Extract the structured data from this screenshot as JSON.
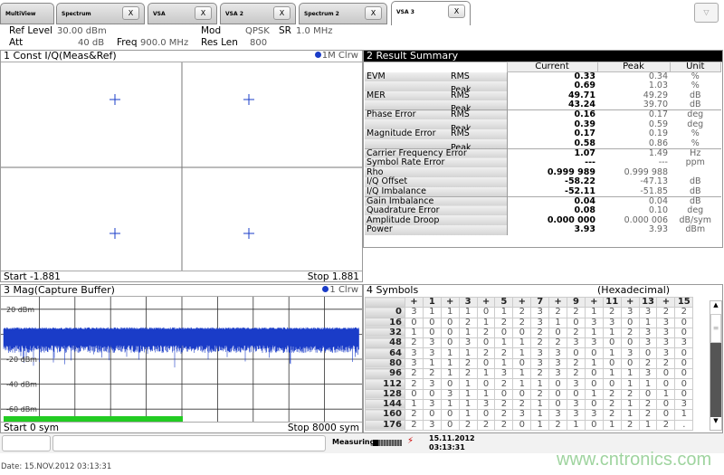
{
  "tabs": [
    {
      "label": "MultiView"
    },
    {
      "label": "Spectrum"
    },
    {
      "label": "VSA"
    },
    {
      "label": "VSA 2"
    },
    {
      "label": "Spectrum 2"
    },
    {
      "label": "VSA 3",
      "active": true
    }
  ],
  "tab_close": "X",
  "dropdown": "▽",
  "settings": {
    "ref_level_label": "Ref Level",
    "ref_level": "30.00 dBm",
    "att_label": "Att",
    "att": "40 dB",
    "freq_label": "Freq",
    "freq": "900.0 MHz",
    "mod_label": "Mod",
    "mod": "QPSK",
    "sr_label": "SR",
    "sr": "1.0 MHz",
    "reslen_label": "Res Len",
    "reslen": "800"
  },
  "const_panel": {
    "title": "1 Const I/Q(Meas&Ref)",
    "trace": "1M Clrw",
    "start": "Start -1.881",
    "stop": "Stop 1.881"
  },
  "mag_panel": {
    "title": "3 Mag(Capture Buffer)",
    "trace": "1 Clrw",
    "start": "Start 0 sym",
    "stop": "Stop 8000 sym",
    "y_labels": [
      "20 dBm",
      "-20 dBm",
      "-40 dBm",
      "-60 dBm"
    ],
    "capture_progress": 0.5
  },
  "summary": {
    "title": "2 Result Summary",
    "headers": [
      "Current",
      "Peak",
      "Unit"
    ],
    "rows": [
      [
        "EVM",
        "RMS",
        "0.33",
        "0.34",
        "%"
      ],
      [
        "",
        "Peak",
        "0.69",
        "1.03",
        "%"
      ],
      [
        "MER",
        "RMS",
        "49.71",
        "49.29",
        "dB"
      ],
      [
        "",
        "Peak",
        "43.24",
        "39.70",
        "dB"
      ],
      [
        "Phase Error",
        "RMS",
        "0.16",
        "0.17",
        "deg"
      ],
      [
        "",
        "Peak",
        "0.39",
        "0.59",
        "deg"
      ],
      [
        "Magnitude Error",
        "RMS",
        "0.17",
        "0.19",
        "%"
      ],
      [
        "",
        "Peak",
        "0.58",
        "0.86",
        "%"
      ],
      [
        "Carrier Frequency Error",
        "",
        "1.07",
        "1.49",
        "Hz"
      ],
      [
        "Symbol Rate Error",
        "",
        "---",
        "---",
        "ppm"
      ],
      [
        "Rho",
        "",
        "0.999 989",
        "0.999 988",
        ""
      ],
      [
        "I/Q Offset",
        "",
        "-58.22",
        "-47.13",
        "dB"
      ],
      [
        "I/Q Imbalance",
        "",
        "-52.11",
        "-51.85",
        "dB"
      ],
      [
        "Gain Imbalance",
        "",
        "0.04",
        "0.04",
        "dB"
      ],
      [
        "Quadrature Error",
        "",
        "0.08",
        "0.10",
        "deg"
      ],
      [
        "Amplitude Droop",
        "",
        "0.000 000",
        "0.000 006",
        "dB/sym"
      ],
      [
        "Power",
        "",
        "3.93",
        "3.93",
        "dBm"
      ]
    ]
  },
  "symbols": {
    "title": "4 Symbols",
    "format": "(Hexadecimal)",
    "col_headers": [
      "+",
      "1",
      "+",
      "3",
      "+",
      "5",
      "+",
      "7",
      "+",
      "9",
      "+",
      "11",
      "+",
      "13",
      "+",
      "15"
    ],
    "rows": [
      {
        "offset": "0",
        "values": [
          "3",
          "1",
          "1",
          "1",
          "0",
          "1",
          "2",
          "3",
          "2",
          "2",
          "1",
          "2",
          "3",
          "3",
          "2",
          "2"
        ]
      },
      {
        "offset": "16",
        "values": [
          "0",
          "0",
          "0",
          "2",
          "1",
          "2",
          "2",
          "3",
          "1",
          "0",
          "3",
          "3",
          "0",
          "1",
          "3",
          "0"
        ]
      },
      {
        "offset": "32",
        "values": [
          "1",
          "0",
          "0",
          "1",
          "2",
          "0",
          "0",
          "2",
          "0",
          "2",
          "1",
          "1",
          "2",
          "3",
          "3",
          "0"
        ]
      },
      {
        "offset": "48",
        "values": [
          "2",
          "3",
          "0",
          "3",
          "0",
          "1",
          "1",
          "2",
          "2",
          "3",
          "3",
          "0",
          "0",
          "3",
          "3",
          "3"
        ]
      },
      {
        "offset": "64",
        "values": [
          "3",
          "3",
          "1",
          "1",
          "2",
          "2",
          "1",
          "3",
          "3",
          "0",
          "0",
          "1",
          "3",
          "0",
          "3",
          "0"
        ]
      },
      {
        "offset": "80",
        "values": [
          "3",
          "1",
          "1",
          "2",
          "0",
          "1",
          "0",
          "3",
          "3",
          "2",
          "1",
          "0",
          "0",
          "2",
          "2",
          "0"
        ]
      },
      {
        "offset": "96",
        "values": [
          "2",
          "2",
          "1",
          "2",
          "1",
          "3",
          "1",
          "2",
          "3",
          "2",
          "0",
          "1",
          "1",
          "3",
          "0",
          "0"
        ]
      },
      {
        "offset": "112",
        "values": [
          "2",
          "3",
          "0",
          "1",
          "0",
          "2",
          "1",
          "1",
          "0",
          "3",
          "0",
          "0",
          "1",
          "1",
          "0",
          "0"
        ]
      },
      {
        "offset": "128",
        "values": [
          "0",
          "0",
          "3",
          "1",
          "1",
          "0",
          "0",
          "2",
          "0",
          "0",
          "1",
          "2",
          "2",
          "0",
          "1",
          "0"
        ]
      },
      {
        "offset": "144",
        "values": [
          "1",
          "3",
          "1",
          "1",
          "3",
          "2",
          "2",
          "1",
          "0",
          "3",
          "0",
          "2",
          "1",
          "2",
          "0",
          "3"
        ]
      },
      {
        "offset": "160",
        "values": [
          "2",
          "0",
          "0",
          "1",
          "0",
          "2",
          "3",
          "1",
          "3",
          "3",
          "3",
          "2",
          "1",
          "2",
          "0",
          "1"
        ]
      },
      {
        "offset": "176",
        "values": [
          "2",
          "3",
          "0",
          "2",
          "2",
          "2",
          "0",
          "1",
          "2",
          "1",
          "0",
          "1",
          "2",
          "1",
          "2",
          "."
        ]
      }
    ]
  },
  "status": {
    "measuring": "Measuring...",
    "date": "15.11.2012",
    "time": "03:13:31"
  },
  "footer_date": "Date: 15.NOV.2012  03:13:31",
  "watermark": "www.cntronics.com",
  "colors": {
    "trace": "#1a3cc8",
    "progress": "#22cc22",
    "title_bar": "#000000"
  }
}
